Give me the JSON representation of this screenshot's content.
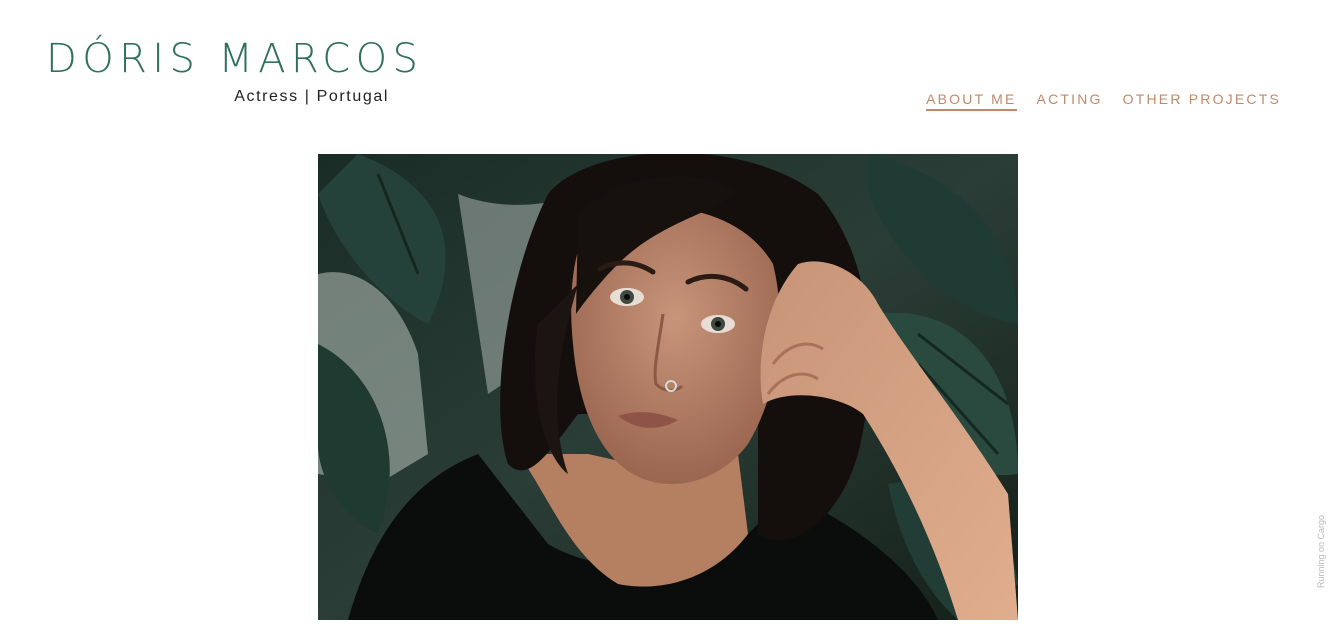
{
  "header": {
    "title": "DÓRIS MARCOS",
    "subtitle": "Actress | Portugal"
  },
  "nav": {
    "items": [
      {
        "label": "ABOUT ME",
        "active": true
      },
      {
        "label": "ACTING",
        "active": false
      },
      {
        "label": "OTHER PROJECTS",
        "active": false
      }
    ]
  },
  "footer": {
    "badge": "Running on Cargo"
  },
  "colors": {
    "title": "#2f6f5e",
    "nav": "#c08a6a",
    "subtitle": "#222222",
    "badge": "#b8b8b8"
  }
}
